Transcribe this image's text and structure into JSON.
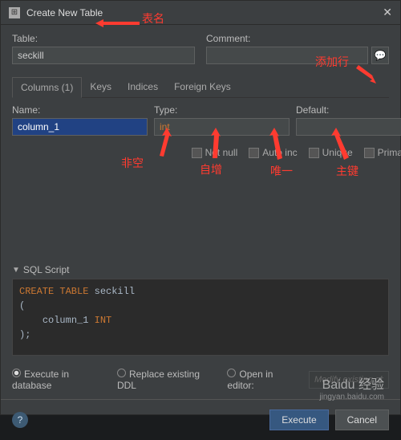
{
  "dialog": {
    "title": "Create New Table"
  },
  "fields": {
    "table_label": "Table:",
    "table_value": "seckill",
    "comment_label": "Comment:",
    "comment_value": ""
  },
  "tabs": {
    "columns": "Columns (1)",
    "keys": "Keys",
    "indices": "Indices",
    "foreign": "Foreign Keys"
  },
  "col": {
    "name_label": "Name:",
    "name_value": "column_1",
    "type_label": "Type:",
    "type_value": "int",
    "default_label": "Default:",
    "default_value": ""
  },
  "checks": {
    "notnull": "Not null",
    "autoinc": "Auto inc",
    "unique": "Unique",
    "primary": "Primary key"
  },
  "sql": {
    "header": "SQL Script",
    "kw_create": "CREATE TABLE",
    "ident": "seckill",
    "col_ident": "column_1",
    "col_type": "INT"
  },
  "exec": {
    "indb": "Execute in database",
    "replace": "Replace existing DDL",
    "open": "Open in editor:",
    "editor_ph": "Modify existing obj..."
  },
  "footer": {
    "execute": "Execute",
    "cancel": "Cancel"
  },
  "annot": {
    "table_name": "表名",
    "add_row": "添加行",
    "notnull": "非空",
    "autoinc": "自增",
    "unique": "唯一",
    "primary": "主键"
  },
  "watermark": {
    "main": "Baidu 经验",
    "sub": "jingyan.baidu.com"
  }
}
